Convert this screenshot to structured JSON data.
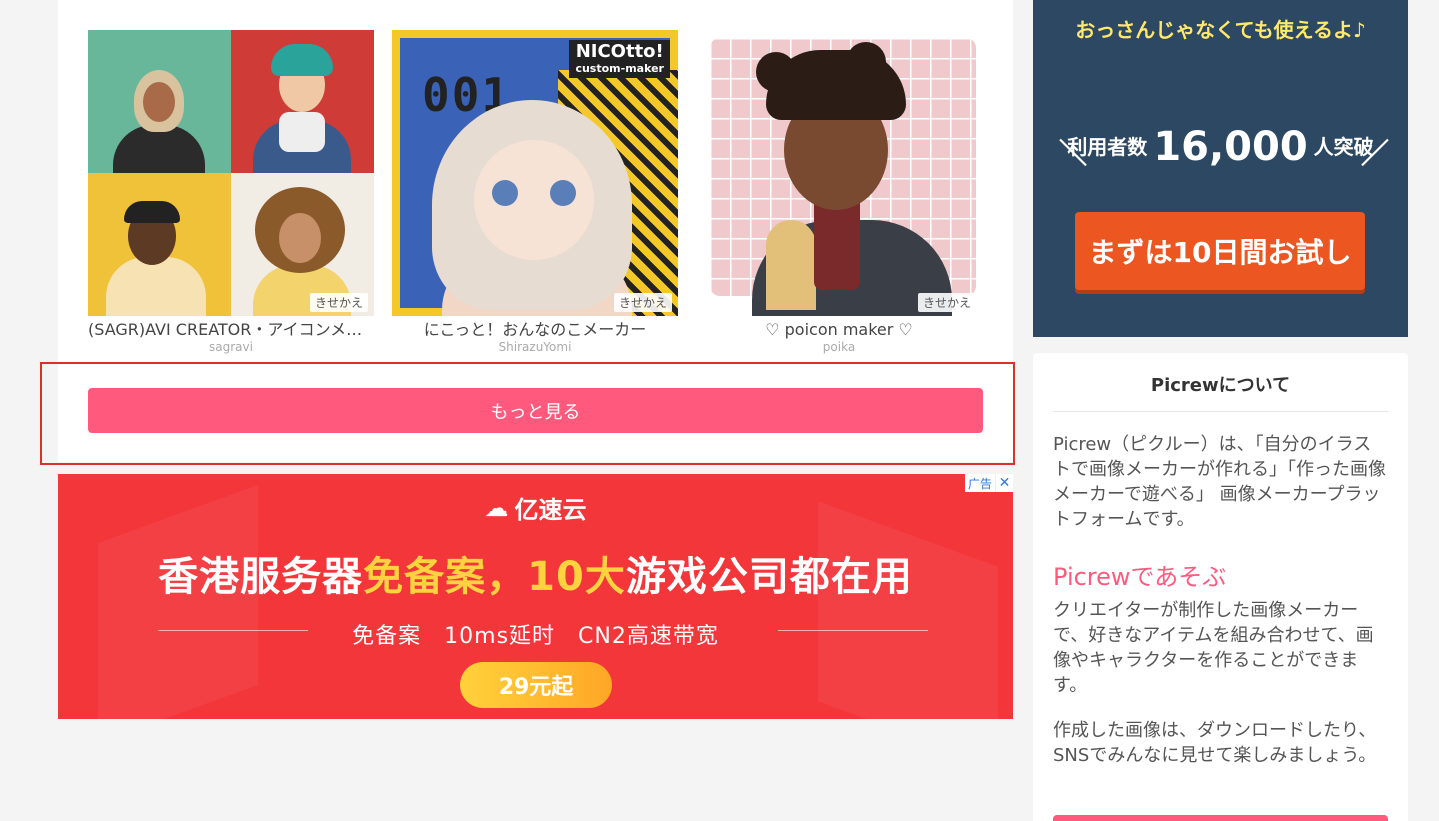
{
  "makers": [
    {
      "title": "(SAGR)AVI CREATOR・アイコンメーカー",
      "author": "sagravi",
      "tag": "きせかえ"
    },
    {
      "title": "にこっと！おんなのこメーカー",
      "author": "ShirazuYomi",
      "tag": "きせかえ",
      "thumb_badge": [
        "NICOtto!",
        "custom-maker"
      ],
      "thumb_number": "001"
    },
    {
      "title": "♡ poicon maker ♡",
      "author": "poika",
      "tag": "きせかえ"
    }
  ],
  "more_button": "もっと見る",
  "ad_banner": {
    "brand": "亿速云",
    "headline_parts": [
      "香港服务器",
      "免备案，10大",
      "游戏公司都在用"
    ],
    "subline": "免备案　10ms延时　CN2高速带宽",
    "cta": "29元起",
    "ad_label": "广告",
    "close_symbol": "✕",
    "colors": {
      "background": "#f3363a",
      "highlight": "#ffd23f"
    }
  },
  "side_ad": {
    "tagline": "おっさんじゃなくても使えるよ♪",
    "users_prefix": "利用者数",
    "users_count": "16,000",
    "users_suffix": "人突破",
    "cta": "まずは10日間お試し"
  },
  "about": {
    "heading": "Picrewについて",
    "description": "Picrew（ピクルー）は、「自分のイラストで画像メーカーが作れる」「作った画像メーカーで遊べる」 画像メーカープラットフォームです。",
    "play_title": "Picrewであそぶ",
    "play_text_1": "クリエイターが制作した画像メーカーで、好きなアイテムを組み合わせて、画像やキャラクターを作ることができます。",
    "play_text_2": "作成した画像は、ダウンロードしたり、SNSでみんなに見せて楽しみましょう。"
  },
  "colors": {
    "accent": "#ff5a7d",
    "page_bg": "#f4f4f5"
  }
}
